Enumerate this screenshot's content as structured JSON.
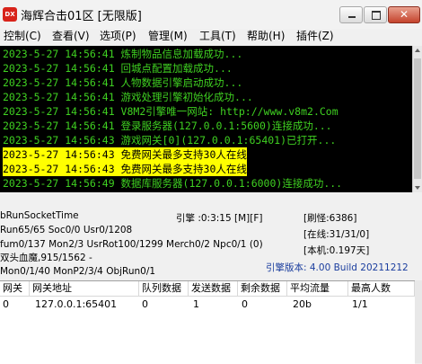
{
  "window": {
    "icon_text": "DX",
    "title": "海辉合击01区 [无限版]",
    "close_glyph": "✕"
  },
  "menu": [
    "控制(C)",
    "查看(V)",
    "选项(P)",
    "管理(M)",
    "工具(T)",
    "帮助(H)",
    "插件(Z)"
  ],
  "log": [
    {
      "text": "2023-5-27 14:56:41 炼制物品信息加载成功...",
      "highlight": false
    },
    {
      "text": "2023-5-27 14:56:41 回城点配置加载成功...",
      "highlight": false
    },
    {
      "text": "2023-5-27 14:56:41 人物数据引擎启动成功...",
      "highlight": false
    },
    {
      "text": "2023-5-27 14:56:41 游戏处理引擎初始化成功...",
      "highlight": false
    },
    {
      "text": "2023-5-27 14:56:41 V8M2引擎唯一网站: http://www.v8m2.Com",
      "highlight": false
    },
    {
      "text": "2023-5-27 14:56:41 登录服务器(127.0.0.1:5600)连接成功...",
      "highlight": false
    },
    {
      "text": "2023-5-27 14:56:43 游戏网关[0](127.0.0.1:65401)已打开...",
      "highlight": false
    },
    {
      "text": "2023-5-27 14:56:43 免费网关最多支持30人在线",
      "highlight": true
    },
    {
      "text": "2023-5-27 14:56:43 免费网关最多支持30人在线",
      "highlight": true
    },
    {
      "text": "2023-5-27 14:56:49 数据库服务器(127.0.0.1:6000)连接成功...",
      "highlight": false
    }
  ],
  "status": {
    "run_socket": "bRunSocketTime",
    "run_line": "Run65/65 Soc0/0 Usr0/1208",
    "hum_line": "fum0/137 Mon2/3 UsrRot100/1299 Merch0/2 Npc0/1 (0)",
    "boss_line": "双头血魔,915/1562 -",
    "mon_line": "Mon0/1/40 MonP2/3/4 ObjRun0/1",
    "engine_time": "引擎 :0:3:15 [M][F]",
    "refresh": "[刷怪:6386]",
    "online": "[在线:31/31/0]",
    "local": "[本机:0.197天]",
    "engine_version": "引擎版本: 4.00 Build 20211212"
  },
  "table": {
    "columns": [
      "网关",
      "网关地址",
      "队列数据",
      "发送数据",
      "剩余数据",
      "平均流量",
      "最高人数"
    ],
    "rows": [
      [
        "0",
        "127.0.0.1:65401",
        "0",
        "1",
        "0",
        "20b",
        "1/1"
      ]
    ]
  }
}
